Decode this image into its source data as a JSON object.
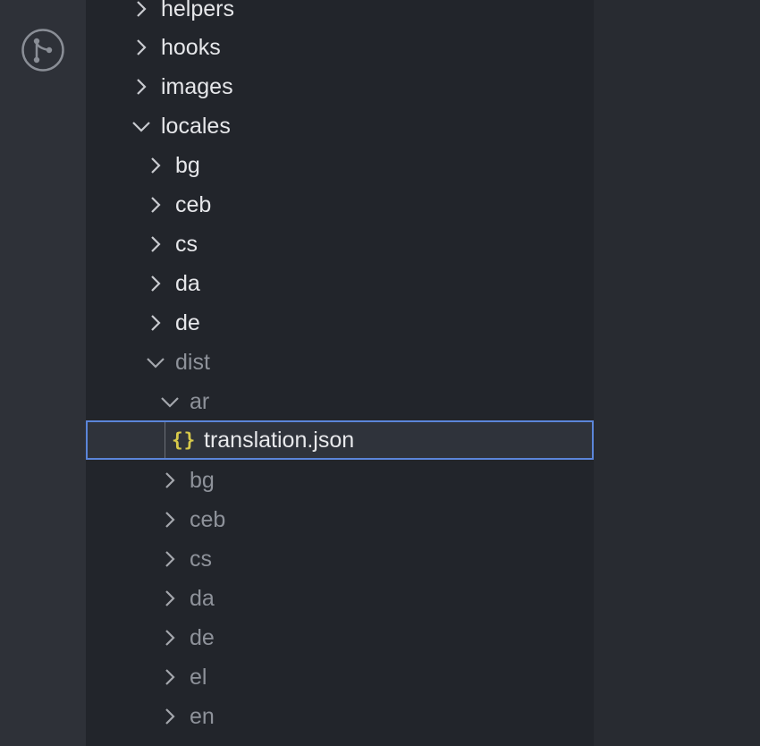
{
  "activity_bar": {
    "icon": "source-control-icon"
  },
  "explorer": {
    "items": [
      {
        "label": "helpers",
        "state": "collapsed"
      },
      {
        "label": "hooks",
        "state": "collapsed"
      },
      {
        "label": "images",
        "state": "collapsed"
      },
      {
        "label": "locales",
        "state": "expanded"
      },
      {
        "label": "bg",
        "state": "collapsed"
      },
      {
        "label": "ceb",
        "state": "collapsed"
      },
      {
        "label": "cs",
        "state": "collapsed"
      },
      {
        "label": "da",
        "state": "collapsed"
      },
      {
        "label": "de",
        "state": "collapsed"
      },
      {
        "label": "dist",
        "state": "expanded"
      },
      {
        "label": "ar",
        "state": "expanded"
      },
      {
        "label": "translation.json",
        "state": "file",
        "icon": "json-file-icon",
        "icon_glyph": "{}",
        "icon_color": "#d7c94a"
      },
      {
        "label": "bg",
        "state": "collapsed"
      },
      {
        "label": "ceb",
        "state": "collapsed"
      },
      {
        "label": "cs",
        "state": "collapsed"
      },
      {
        "label": "da",
        "state": "collapsed"
      },
      {
        "label": "de",
        "state": "collapsed"
      },
      {
        "label": "el",
        "state": "collapsed"
      },
      {
        "label": "en",
        "state": "collapsed"
      }
    ]
  },
  "colors": {
    "activity_bar_bg": "#2e3138",
    "explorer_bg": "#22252b",
    "selection_border": "#5b85d9",
    "text_bright": "#e6e7ea",
    "text_dim": "#8e929a"
  }
}
